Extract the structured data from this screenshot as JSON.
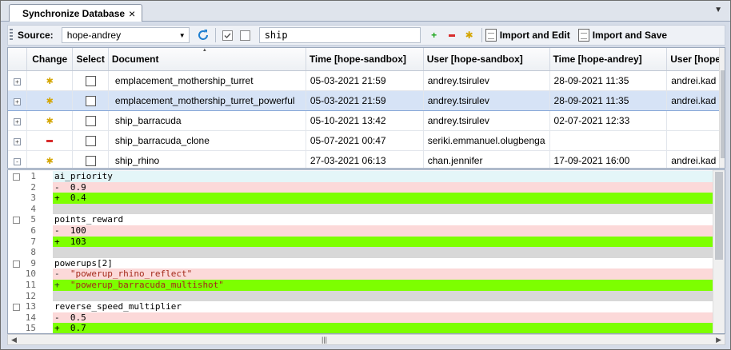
{
  "tab": {
    "title": "Synchronize Database",
    "close": "×"
  },
  "toolbar": {
    "source_label": "Source:",
    "source_value": "hope-andrey",
    "filter_value": "ship",
    "import_edit_label": "Import and Edit",
    "import_save_label": "Import and Save"
  },
  "grid": {
    "columns": [
      "Change",
      "Select",
      "Document",
      "Time [hope-sandbox]",
      "User [hope-sandbox]",
      "Time [hope-andrey]",
      "User [hope"
    ],
    "rows": [
      {
        "expand": "+",
        "change": "modified",
        "document": "emplacement_mothership_turret",
        "time_sandbox": "05-03-2021 21:59",
        "user_sandbox": "andrey.tsirulev",
        "time_andrey": "28-09-2021 11:35",
        "user_andrey": "andrei.kad"
      },
      {
        "expand": "+",
        "change": "modified",
        "document": "emplacement_mothership_turret_powerful",
        "time_sandbox": "05-03-2021 21:59",
        "user_sandbox": "andrey.tsirulev",
        "time_andrey": "28-09-2021 11:35",
        "user_andrey": "andrei.kad"
      },
      {
        "expand": "+",
        "change": "modified",
        "document": "ship_barracuda",
        "time_sandbox": "05-10-2021 13:42",
        "user_sandbox": "andrey.tsirulev",
        "time_andrey": "02-07-2021 12:33",
        "user_andrey": ""
      },
      {
        "expand": "+",
        "change": "removed",
        "document": "ship_barracuda_clone",
        "time_sandbox": "05-07-2021 00:47",
        "user_sandbox": "seriki.emmanuel.olugbenga",
        "time_andrey": "",
        "user_andrey": ""
      },
      {
        "expand": "-",
        "change": "modified",
        "document": "ship_rhino",
        "time_sandbox": "27-03-2021 06:13",
        "user_sandbox": "chan.jennifer",
        "time_andrey": "17-09-2021 16:00",
        "user_andrey": "andrei.kad"
      }
    ],
    "selected_row": 1
  },
  "diff": {
    "lines": [
      {
        "n": "1",
        "kind": "hdr",
        "check": true,
        "text": "ai_priority"
      },
      {
        "n": "2",
        "kind": "del",
        "check": false,
        "text": "-  0.9"
      },
      {
        "n": "3",
        "kind": "add",
        "check": false,
        "text": "+  0.4"
      },
      {
        "n": "4",
        "kind": "gap",
        "check": false,
        "text": ""
      },
      {
        "n": "5",
        "kind": "plain",
        "check": true,
        "text": "points_reward"
      },
      {
        "n": "6",
        "kind": "del",
        "check": false,
        "text": "-  100"
      },
      {
        "n": "7",
        "kind": "add",
        "check": false,
        "text": "+  103"
      },
      {
        "n": "8",
        "kind": "gap",
        "check": false,
        "text": ""
      },
      {
        "n": "9",
        "kind": "plain",
        "check": true,
        "text": "powerups[2]"
      },
      {
        "n": "10",
        "kind": "del",
        "check": false,
        "text": "-  \"powerup_rhino_reflect\""
      },
      {
        "n": "11",
        "kind": "add",
        "check": false,
        "text": "+  \"powerup_barracuda_multishot\""
      },
      {
        "n": "12",
        "kind": "gap",
        "check": false,
        "text": ""
      },
      {
        "n": "13",
        "kind": "plain",
        "check": true,
        "text": "reverse_speed_multiplier"
      },
      {
        "n": "14",
        "kind": "del",
        "check": false,
        "text": "-  0.5"
      },
      {
        "n": "15",
        "kind": "add",
        "check": false,
        "text": "+  0.7"
      }
    ]
  },
  "colors": {
    "added": "#7dff00",
    "removed": "#fcd9d9",
    "header": "#e4f6f8",
    "modified_icon": "#d4a500",
    "removed_icon": "#d82c2c"
  },
  "icons": {
    "modified": "asterisk-icon",
    "removed": "minus-icon",
    "refresh": "refresh-icon",
    "add": "plus-icon",
    "remove": "minus-icon"
  }
}
